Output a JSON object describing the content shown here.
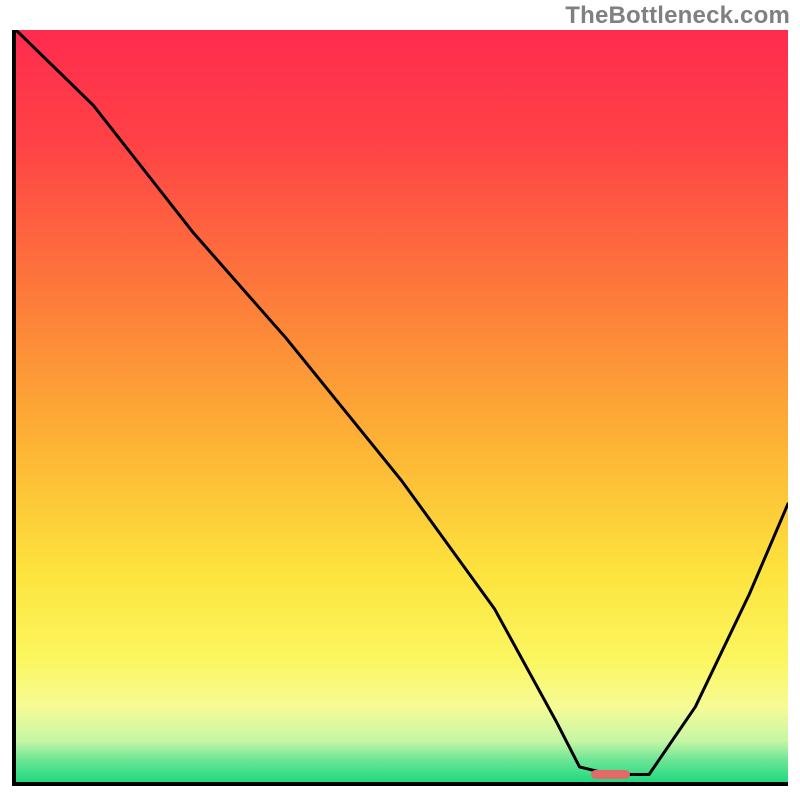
{
  "watermark": "TheBottleneck.com",
  "chart_data": {
    "type": "line",
    "title": "",
    "xlabel": "",
    "ylabel": "",
    "xlim": [
      0,
      100
    ],
    "ylim": [
      0,
      100
    ],
    "grid": false,
    "series": [
      {
        "name": "bottleneck-curve",
        "x": [
          0,
          10,
          23,
          35,
          50,
          62,
          70,
          73,
          77,
          82,
          88,
          95,
          100
        ],
        "values": [
          100,
          90,
          73,
          59,
          40,
          23,
          8,
          2,
          1,
          1,
          10,
          25,
          37
        ]
      }
    ],
    "annotations": [
      {
        "name": "optimal-marker",
        "x": 77,
        "y": 1,
        "width_pct": 5,
        "height_pct": 1.3,
        "color": "#e46a6a"
      }
    ],
    "background_gradient_stops": [
      {
        "pos": 0.0,
        "color": "#ff2b4f"
      },
      {
        "pos": 0.15,
        "color": "#ff4246"
      },
      {
        "pos": 0.35,
        "color": "#fd7a3a"
      },
      {
        "pos": 0.55,
        "color": "#fdb335"
      },
      {
        "pos": 0.72,
        "color": "#fde33d"
      },
      {
        "pos": 0.84,
        "color": "#fbf761"
      },
      {
        "pos": 0.9,
        "color": "#f6fb96"
      },
      {
        "pos": 0.945,
        "color": "#c7f6a5"
      },
      {
        "pos": 0.97,
        "color": "#6fe696"
      },
      {
        "pos": 1.0,
        "color": "#1fd97e"
      }
    ]
  }
}
